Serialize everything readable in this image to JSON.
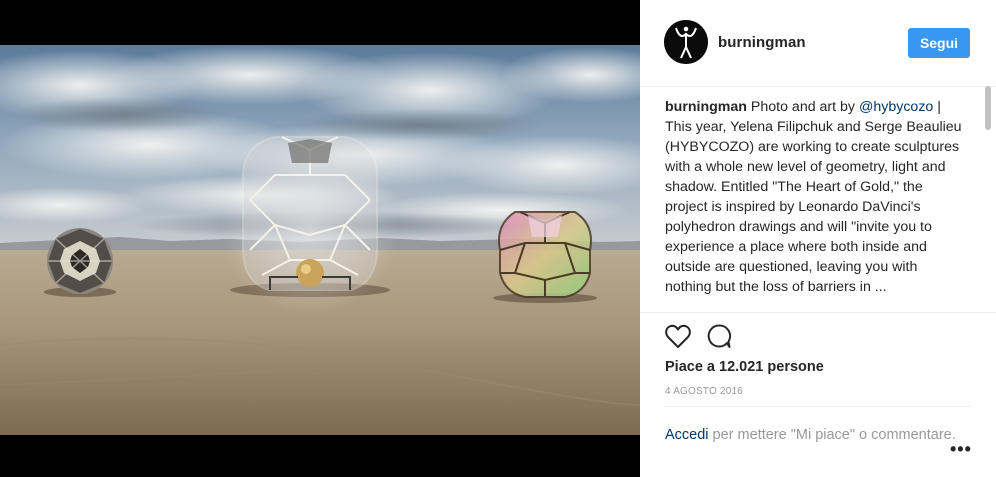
{
  "post": {
    "username": "burningman",
    "follow_label": "Segui",
    "caption": {
      "username": "burningman",
      "text_1": " Photo and art by ",
      "mention": "@hybycozo",
      "text_2": " | This year, Yelena Filipchuk and Serge Beaulieu (HYBYCOZO) are working to create sculptures with a whole new level of geometry, light and shadow. Entitled \"The Heart of Gold,\" the project is inspired by Leonardo DaVinci's polyhedron drawings and will \"invite you to experience a place where both inside and outside are questioned, leaving you with nothing but the loss of barriers in ..."
    },
    "likes": "Piace a 12.021 persone",
    "date": "4 AGOSTO 2016",
    "login": {
      "link": "Accedi",
      "text": " per mettere \"Mi piace\" o commentare."
    },
    "more_label": "•••"
  },
  "icons": {
    "like": "heart-outline-icon",
    "comment": "comment-bubble-icon",
    "more": "ellipsis-icon"
  },
  "colors": {
    "accent": "#3897f0",
    "link": "#003569",
    "text": "#262626",
    "muted": "#999999"
  }
}
